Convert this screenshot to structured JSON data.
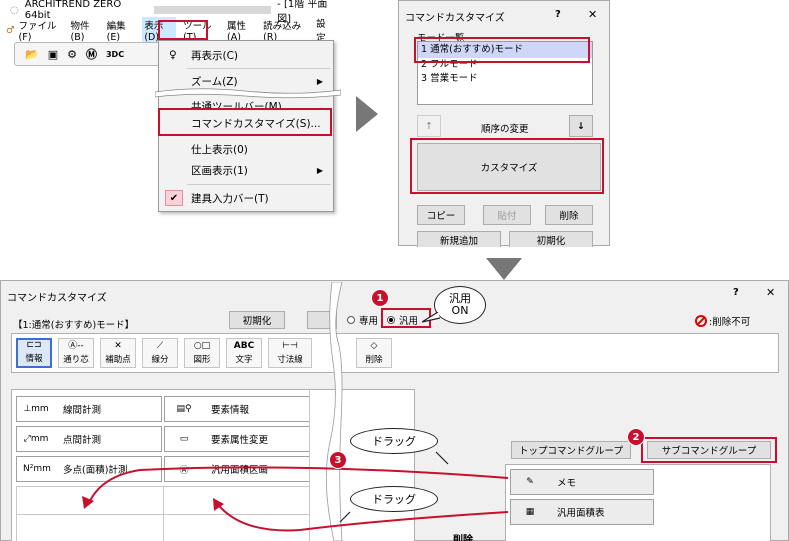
{
  "main_window": {
    "title": "ARCHITREND ZERO 64bit",
    "title_suffix": "- [1階 平面図]",
    "menu": [
      "ファイル(F)",
      "物件(B)",
      "編集(E)",
      "表示(D)",
      "ツール(T)",
      "属性(A)",
      "読み込み(R)",
      "設定"
    ],
    "toolbar_3d": "3DC"
  },
  "view_menu": {
    "items": [
      {
        "label": "再表示(C)"
      },
      {
        "label": "ズーム(Z)"
      },
      {
        "label": "共通ツールバー(M)..."
      },
      {
        "label": "コマンドカスタマイズ(S)..."
      },
      {
        "label": "仕上表示(0)"
      },
      {
        "label": "区画表示(1)"
      },
      {
        "label": "建具入力バー(T)"
      }
    ]
  },
  "small_dialog": {
    "title": "コマンドカスタマイズ",
    "help": "?",
    "close": "✕",
    "mode_list_label": "モード一覧",
    "modes": [
      "1 通常(おすすめ)モード",
      "2 フルモード",
      "3 営業モード"
    ],
    "up_arrow": "↑",
    "reorder_label": "順序の変更",
    "down_arrow": "↓",
    "customize_button": "カスタマイズ",
    "copy_button": "コピー",
    "paste_button": "貼付",
    "delete_button": "削除",
    "new_button": "新規追加",
    "reset_button": "初期化"
  },
  "big_dialog": {
    "title": "コマンドカスタマイズ",
    "help": "?",
    "close": "✕",
    "mode_name": "【1:通常(おすすめ)モード】",
    "reset_button": "初期化",
    "radio_exclusive": "専用",
    "radio_general": "汎用",
    "delete_legend": ":削除不可",
    "toolbar": [
      "情報",
      "通り芯",
      "補助点",
      "線分",
      "図形",
      "文字",
      "寸法線",
      "削除"
    ],
    "grid_left": [
      "線間計測",
      "点間計測",
      "多点(面積)計測"
    ],
    "grid_mid": [
      "要素情報",
      "要素属性変更",
      "汎用面積区画"
    ],
    "tab_top": "トップコマンドグループ",
    "tab_sub": "サブコマンドグループ",
    "sub_items": [
      "メモ",
      "汎用面積表"
    ],
    "delete_area": "削除"
  },
  "annotations": {
    "general_on_callout": [
      "汎用",
      "ON"
    ],
    "drag_label": "ドラッグ",
    "badge_1": "1",
    "badge_2": "2",
    "badge_3": "3"
  },
  "colors": {
    "highlight_red": "#c8102e",
    "menu_highlight": "#cce8ff",
    "selected_row": "#cfe1f7"
  }
}
